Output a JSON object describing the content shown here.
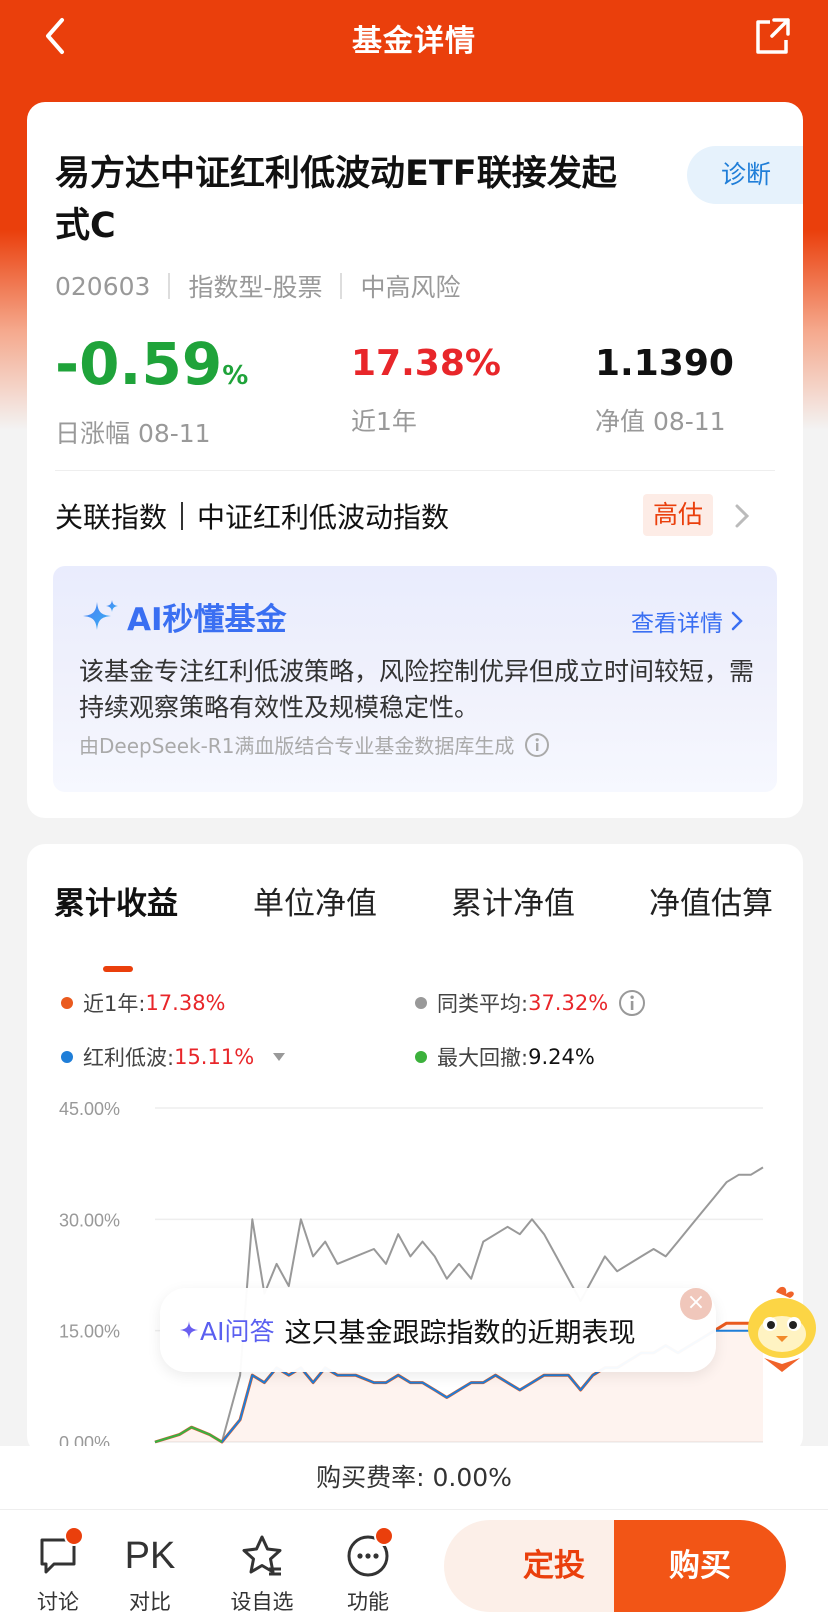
{
  "nav": {
    "title": "基金详情"
  },
  "fund": {
    "name": "易方达中证红利低波动ETF联接发起式C",
    "code": "020603",
    "type": "指数型-股票",
    "risk": "中高风险",
    "diagnose_label": "诊断",
    "daily_change": "-0.59",
    "daily_change_unit": "%",
    "daily_change_label": "日涨幅 08-11",
    "year_return": "17.38%",
    "year_return_label": "近1年",
    "nav_value": "1.1390",
    "nav_label": "净值 08-11",
    "related_index_label": "关联指数",
    "related_index": "中证红利低波动指数",
    "valuation_badge": "高估"
  },
  "ai_card": {
    "title": "AI秒懂基金",
    "detail_link": "查看详情",
    "summary": "该基金专注红利低波策略，风险控制优异但成立时间较短，需持续观察策略有效性及规模稳定性。",
    "source": "由DeepSeek-R1满血版结合专业基金数据库生成"
  },
  "chart_tabs": [
    "累计收益",
    "单位净值",
    "累计净值",
    "净值估算"
  ],
  "legend": {
    "item1_label": "近1年:",
    "item1_value": "17.38%",
    "item2_label": "同类平均:",
    "item2_value": "37.32%",
    "item3_label": "红利低波:",
    "item3_value": "15.11%",
    "item4_label": "最大回撤:",
    "item4_value": "9.24%"
  },
  "chart_data": {
    "type": "line",
    "yticks": [
      "45.00%",
      "30.00%",
      "15.00%",
      "0.00%"
    ],
    "ylim": [
      0,
      45
    ],
    "x": [
      0,
      4,
      6,
      9,
      11,
      14,
      16,
      18,
      20,
      22,
      24,
      26,
      28,
      30,
      33,
      36,
      38,
      40,
      42,
      44,
      46,
      48,
      50,
      52,
      54,
      56,
      58,
      60,
      62,
      64,
      66,
      68,
      70,
      72,
      74,
      76,
      78,
      80,
      82,
      84,
      86,
      88,
      90,
      92,
      94,
      96,
      98,
      100
    ],
    "series": [
      {
        "name": "同类平均",
        "color": "#999999",
        "values": [
          0,
          1,
          2,
          1,
          0,
          9,
          30,
          20,
          24,
          21,
          30,
          25,
          27,
          24,
          25,
          26,
          24,
          28,
          25,
          27,
          25,
          22,
          24,
          22,
          27,
          28,
          29,
          28,
          30,
          28,
          25,
          22,
          19,
          22,
          25,
          23,
          24,
          25,
          26,
          25,
          27,
          29,
          31,
          33,
          35,
          36,
          36,
          37
        ]
      },
      {
        "name": "近1年",
        "color": "#ea5a1e",
        "values": [
          0,
          1,
          2,
          1,
          0,
          3,
          9,
          8,
          10,
          9,
          10,
          8,
          10,
          9,
          9,
          8,
          8,
          9,
          8,
          8,
          7,
          6,
          7,
          8,
          8,
          9,
          8,
          7,
          8,
          9,
          9,
          9,
          7,
          9,
          10,
          10,
          11,
          12,
          12,
          13,
          12,
          13,
          14,
          15,
          16,
          16,
          16,
          17
        ]
      },
      {
        "name": "红利低波",
        "color": "#1f7ed8",
        "values": [
          0,
          1,
          2,
          1,
          0,
          3,
          9,
          8,
          10,
          9,
          10,
          8,
          10,
          9,
          9,
          8,
          8,
          9,
          8,
          8,
          7,
          6,
          7,
          8,
          8,
          9,
          8,
          7,
          8,
          9,
          9,
          9,
          7,
          9,
          10,
          10,
          11,
          12,
          12,
          13,
          12,
          13,
          14,
          15,
          15,
          15,
          15,
          15
        ]
      },
      {
        "name": "最大回撤",
        "color": "#3cb13c",
        "values": [
          0,
          1,
          2,
          1,
          0
        ]
      }
    ]
  },
  "ai_bubble": {
    "tag": "AI问答",
    "text": "这只基金跟踪指数的近期表现"
  },
  "fee": "购买费率: 0.00%",
  "bottom": {
    "discuss": "讨论",
    "compare_icon": "PK",
    "compare": "对比",
    "watchlist": "设自选",
    "features": "功能",
    "sip": "定投",
    "buy": "购买"
  }
}
